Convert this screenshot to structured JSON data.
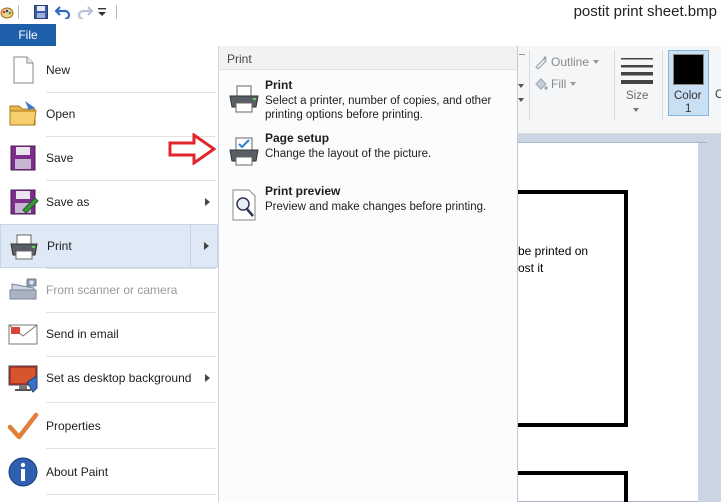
{
  "window": {
    "title": "postit print sheet.bmp"
  },
  "file_tab": {
    "label": "File"
  },
  "left_menu": {
    "items": [
      {
        "label": "New"
      },
      {
        "label": "Open"
      },
      {
        "label": "Save"
      },
      {
        "label": "Save as"
      },
      {
        "label": "Print"
      },
      {
        "label": "From scanner or camera"
      },
      {
        "label": "Send in email"
      },
      {
        "label": "Set as desktop background"
      },
      {
        "label": "Properties"
      },
      {
        "label": "About Paint"
      }
    ]
  },
  "submenu": {
    "header": "Print",
    "items": [
      {
        "title": "Print",
        "desc": "Select a printer, number of copies, and other printing options before printing."
      },
      {
        "title": "Page setup",
        "desc": "Change the layout of the picture."
      },
      {
        "title": "Print preview",
        "desc": "Preview and make changes before printing."
      }
    ]
  },
  "ribbon": {
    "outline_label": "Outline",
    "fill_label": "Fill",
    "size_label": "Size",
    "color1_label": "Color",
    "color1_num": "1",
    "color2_partial": "C"
  },
  "canvas": {
    "text_line1": "be printed on",
    "text_line2": "ost it"
  },
  "colors": {
    "file_tab": "#1d5fa8",
    "active_item": "#dfe9f5",
    "annotation_arrow": "#e0252c",
    "color1_swatch": "#000000"
  }
}
